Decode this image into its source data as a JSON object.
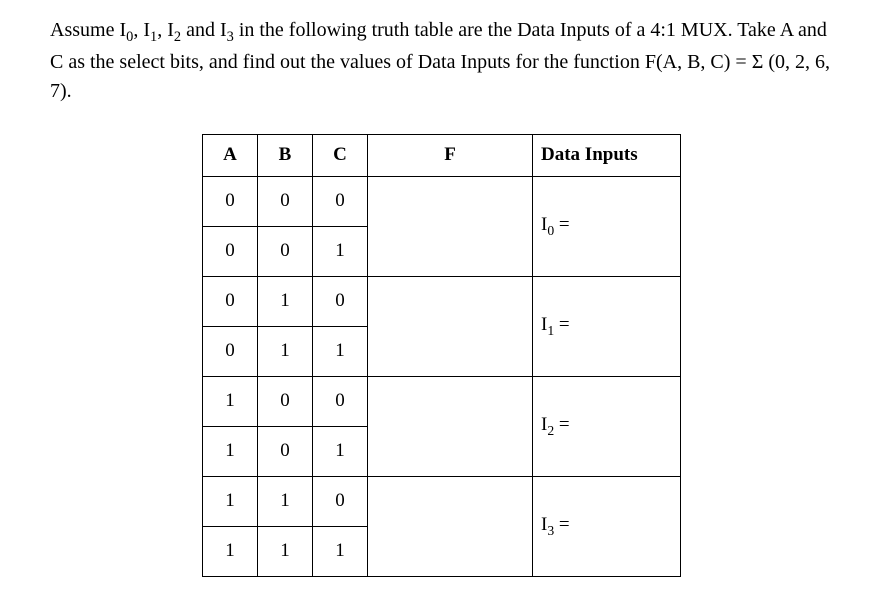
{
  "problem_text_parts": {
    "p1": "Assume I",
    "sub0": "0",
    "p2": ", I",
    "sub1": "1",
    "p3": ", I",
    "sub2": "2",
    "p4": " and I",
    "sub3": "3",
    "p5": " in the following truth table are the Data Inputs of a 4:1 MUX. Take A and C as the select bits, and find out the values of Data Inputs for the function F(A, B, C) = Σ (0, 2, 6, 7)."
  },
  "headers": {
    "a": "A",
    "b": "B",
    "c": "C",
    "f": "F",
    "di": "Data Inputs"
  },
  "rows": [
    {
      "a": "0",
      "b": "0",
      "c": "0"
    },
    {
      "a": "0",
      "b": "0",
      "c": "1"
    },
    {
      "a": "0",
      "b": "1",
      "c": "0"
    },
    {
      "a": "0",
      "b": "1",
      "c": "1"
    },
    {
      "a": "1",
      "b": "0",
      "c": "0"
    },
    {
      "a": "1",
      "b": "0",
      "c": "1"
    },
    {
      "a": "1",
      "b": "1",
      "c": "0"
    },
    {
      "a": "1",
      "b": "1",
      "c": "1"
    }
  ],
  "data_inputs": [
    {
      "base": "I",
      "sub": "0",
      "suffix": " ="
    },
    {
      "base": "I",
      "sub": "1",
      "suffix": " ="
    },
    {
      "base": "I",
      "sub": "2",
      "suffix": " ="
    },
    {
      "base": "I",
      "sub": "3",
      "suffix": " ="
    }
  ]
}
